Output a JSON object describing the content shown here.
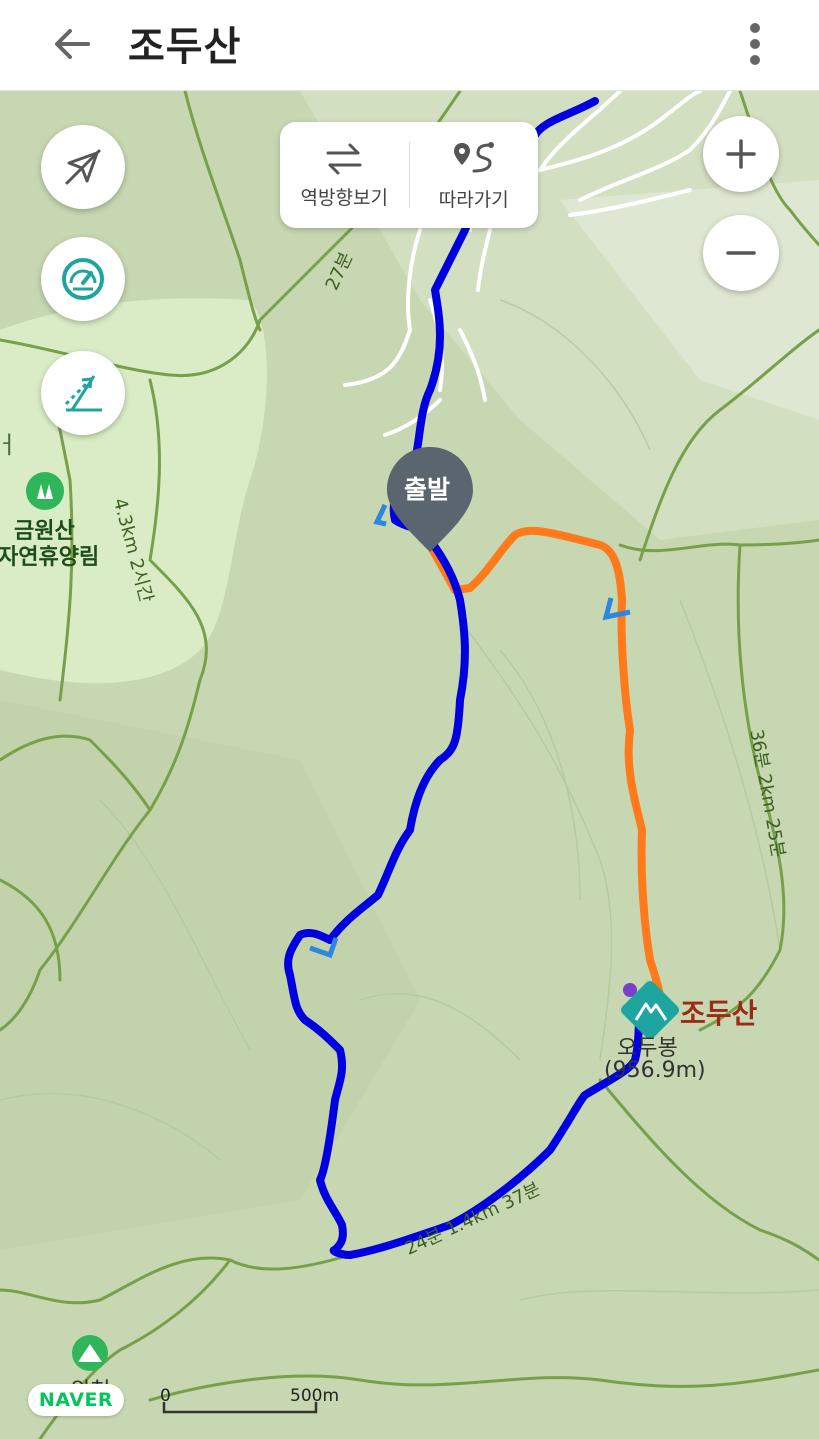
{
  "header": {
    "title": "조두산",
    "back_icon": "arrow-left-icon",
    "more_icon": "more-vertical-icon"
  },
  "actions": [
    {
      "label": "역방향보기",
      "icon": "swap-arrows-icon"
    },
    {
      "label": "따라가기",
      "icon": "route-follow-icon"
    }
  ],
  "side_buttons": [
    "no-compass-icon",
    "speedometer-icon",
    "elevation-icon"
  ],
  "zoom": {
    "in_label": "+",
    "out_label": "−"
  },
  "map_labels": {
    "forest_name": "금원산",
    "forest_name_2": "자연휴양림",
    "left_edge": "ㅓ",
    "peak_name": "조두산",
    "summit": "오두봉",
    "summit_elev": "(956.9m)",
    "trail_1": "4.3km 2시간",
    "trail_2": "36분 2km 25분",
    "trail_3": "24분 1.4km 37분",
    "trail_4": "27분",
    "bottom_place": "위천"
  },
  "start_marker": "출발",
  "brand": "NAVER",
  "scale": {
    "zero": "0",
    "max": "500m"
  },
  "colors": {
    "main_route": "#0000e0",
    "alt_route": "#ff7a1a",
    "forest_fill": "#d9ecc5",
    "peak_icon": "#1fa5a0",
    "peak_label": "#9b2b16",
    "naver_green": "#03c75a"
  }
}
